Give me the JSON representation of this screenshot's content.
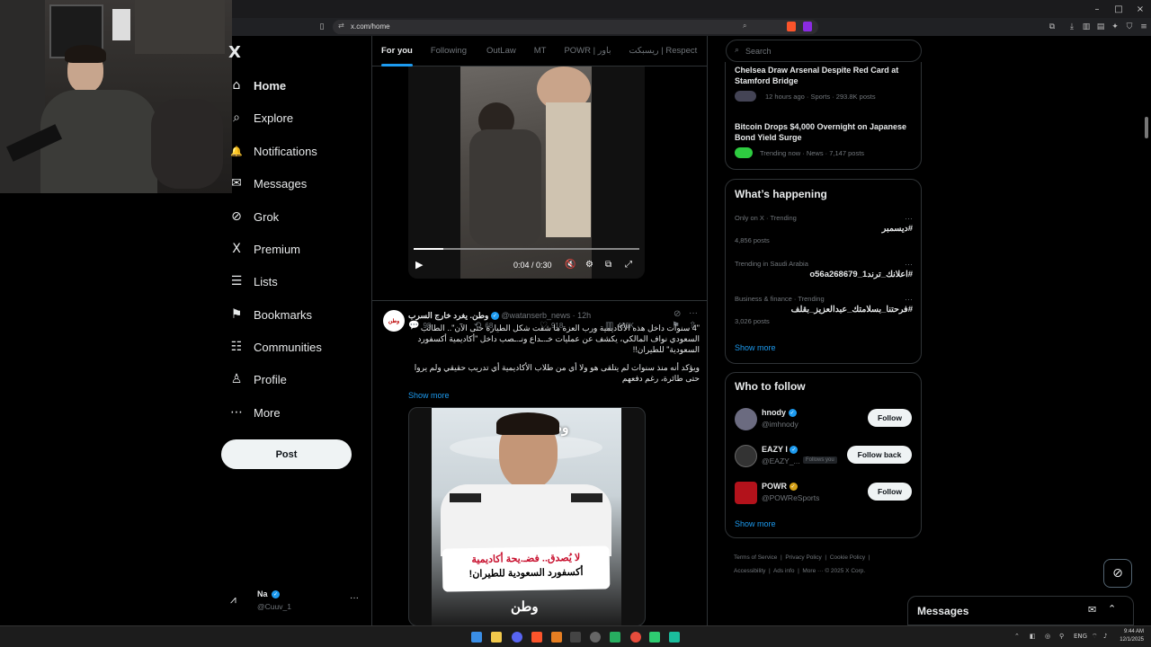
{
  "browser": {
    "url": "x.com/home",
    "window_controls": [
      "–",
      "□",
      "×"
    ]
  },
  "sidebar": {
    "logo": "X",
    "items": [
      {
        "label": "Home",
        "icon": "home-icon",
        "glyph": "⌂"
      },
      {
        "label": "Explore",
        "icon": "search-icon",
        "glyph": "⌕"
      },
      {
        "label": "Notifications",
        "icon": "bell-icon",
        "glyph": "🔔"
      },
      {
        "label": "Messages",
        "icon": "envelope-icon",
        "glyph": "✉"
      },
      {
        "label": "Grok",
        "icon": "grok-icon",
        "glyph": "⊘"
      },
      {
        "label": "Premium",
        "icon": "x-premium-icon",
        "glyph": "X"
      },
      {
        "label": "Lists",
        "icon": "list-icon",
        "glyph": "☰"
      },
      {
        "label": "Bookmarks",
        "icon": "bookmark-icon",
        "glyph": "⚑"
      },
      {
        "label": "Communities",
        "icon": "people-icon",
        "glyph": "☷"
      },
      {
        "label": "Profile",
        "icon": "person-icon",
        "glyph": "♙"
      },
      {
        "label": "More",
        "icon": "more-circle-icon",
        "glyph": "⋯"
      }
    ],
    "post_label": "Post",
    "account": {
      "name": "Na",
      "handle": "@Cuuv_1"
    }
  },
  "feed": {
    "tabs": [
      "For you",
      "Following",
      "OutLaw",
      "MT",
      "POWR | باور",
      "ريسبكت | Respect"
    ],
    "tweet1": {
      "video_time": "0:04 / 0:30",
      "progress": 0.13,
      "replies": "98",
      "reposts": "68",
      "likes": "918",
      "views": "400K"
    },
    "tweet2": {
      "avatar_text": "وطن",
      "name": "وطن. يغرد خارج السرب",
      "handle": "@watanserb_news",
      "time": "12h",
      "text": "\"4 سنوات داخل هذه الأكاديمية ورب العزة ما شفت شكل الطيارة حتى الآن\".. الطالب السعودي نواف المالكي، يكشف عن عمليات خـ.ـداع ونـ.ـصب داخل \"أكاديمية أكسفورد السعودية\" للطيران!!",
      "text2": "ويؤكد أنه منذ سنوات لم يتلقى هو ولا أي من طلاب الأكاديمية أي تدريب حقيقي ولم يروا حتى طائرة، رغم دفعهم",
      "show_more": "Show more",
      "media_logo": "وطن",
      "media_caption1": "لا يُصدق.. فضـ.يحة أكاديمية",
      "media_caption2": "أكسفورد السعودية للطيران!",
      "media_bottom": "وطن"
    }
  },
  "right": {
    "search_placeholder": "Search",
    "news": [
      {
        "title": "Chelsea Draw Arsenal Despite Red Card at Stamford Bridge",
        "meta": "12 hours ago · Sports · 293.8K posts"
      },
      {
        "title": "Bitcoin Drops $4,000 Overnight on Japanese Bond Yield Surge",
        "meta": "Trending now · News · 7,147 posts"
      }
    ],
    "happening": {
      "title": "What’s happening",
      "items": [
        {
          "context": "Only on X · Trending",
          "tag": "#ديسمبر",
          "count": "4,856 posts"
        },
        {
          "context": "Trending in Saudi Arabia",
          "tag": "#اعلانك_ترند1_o56a268679",
          "count": ""
        },
        {
          "context": "Business & finance · Trending",
          "tag": "#فرحتنا_بسلامتك_عبدالعزيز_بقلف",
          "count": "3,026 posts"
        }
      ],
      "show_more": "Show more"
    },
    "who_to_follow": {
      "title": "Who to follow",
      "users": [
        {
          "name": "hnody",
          "handle": "@imhnody",
          "button": "Follow",
          "badge": "",
          "badge_color": "#1d9bf0",
          "avatar_color": "#6b6b80"
        },
        {
          "name": "EAZY I",
          "handle": "@EAZY_...",
          "button": "Follow back",
          "badge": "Follows you",
          "badge_color": "#1d9bf0",
          "avatar_color": "#333333"
        },
        {
          "name": "POWR",
          "handle": "@POWReSports",
          "button": "Follow",
          "badge": "",
          "badge_color": "#d4a017",
          "avatar_color": "#b3121b"
        }
      ],
      "show_more": "Show more"
    },
    "footer": [
      "Terms of Service",
      "Privacy Policy",
      "Cookie Policy",
      "Accessibility",
      "Ads info",
      "More ···",
      "© 2025 X Corp."
    ],
    "messages_label": "Messages"
  },
  "taskbar": {
    "time": "9:44 AM",
    "date": "12/1/2025",
    "lang": "ENG"
  }
}
